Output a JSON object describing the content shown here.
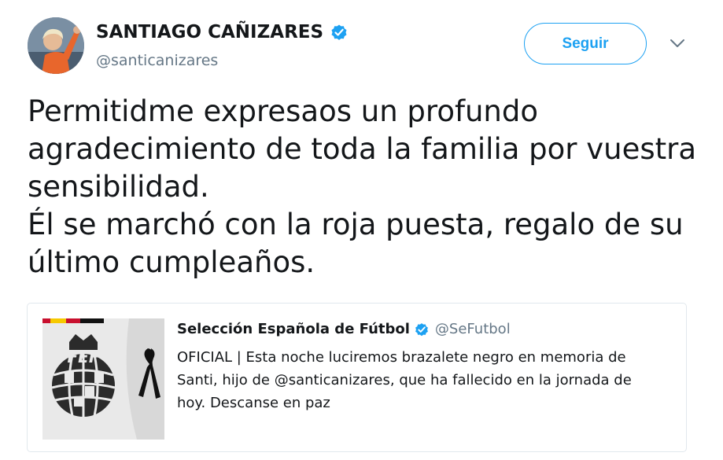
{
  "tweet": {
    "display_name": "SANTIAGO CAÑIZARES",
    "handle": "@santicanizares",
    "verified_icon": "verified-badge-icon",
    "follow_label": "Seguir",
    "caret_icon": "chevron-down-icon",
    "text_lines": [
      "Permitidme expresaos un profundo",
      "agradecimiento de toda la familia por vuestra",
      "sensibilidad.",
      "Él se marchó con la roja puesta, regalo de su",
      "último cumpleaños."
    ]
  },
  "quoted": {
    "display_name": "Selección Española de Fútbol",
    "handle": "@SeFutbol",
    "image_icon": "rfef-crest-mourning-ribbon-image",
    "text_lines": [
      "OFICIAL | Esta noche luciremos brazalete negro en memoria de",
      "Santi, hijo de @santicanizares, que ha fallecido en la jornada de",
      "hoy. Descanse en paz"
    ]
  },
  "colors": {
    "accent": "#1da1f2",
    "text": "#14171a",
    "secondary": "#657786",
    "border": "#e1e8ed"
  }
}
